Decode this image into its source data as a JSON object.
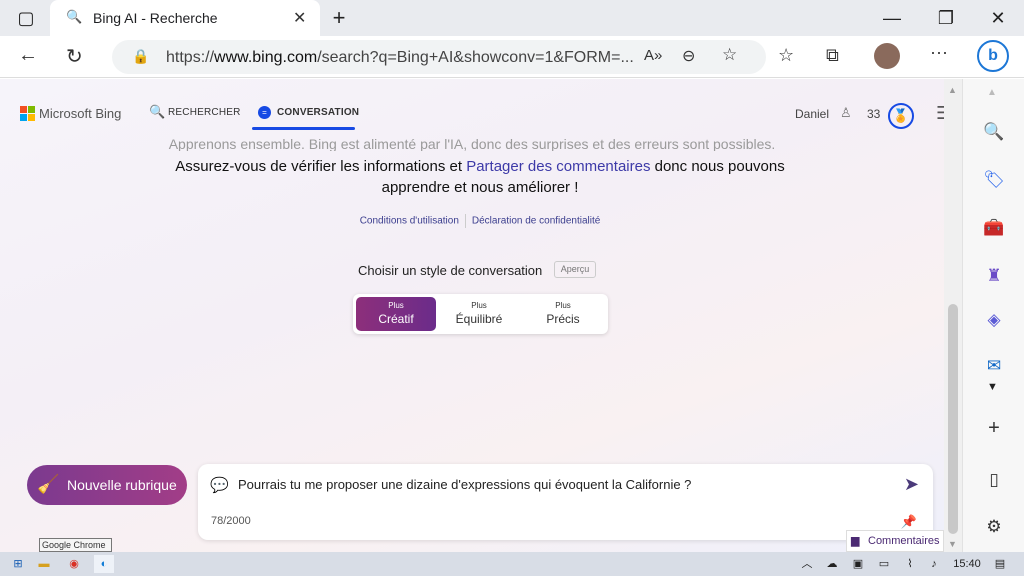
{
  "browser": {
    "tab_title": "Bing AI - Recherche",
    "url_prefix": "https://",
    "url_domain": "www.bing.com",
    "url_rest": "/search?q=Bing+AI&showconv=1&FORM=..."
  },
  "bing": {
    "brand": "Microsoft Bing",
    "nav_search": "RECHERCHER",
    "nav_chat": "CONVERSATION",
    "user_name": "Daniel",
    "points": "33"
  },
  "disclaimer": {
    "line1": "Apprenons ensemble. Bing est alimenté par l'IA, donc des surprises et des erreurs sont possibles.",
    "line2_a": "Assurez-vous de vérifier les informations et ",
    "line2_link": "Partager des commentaires",
    "line2_b": " donc nous pouvons",
    "line3": "apprendre et nous améliorer !"
  },
  "links": {
    "terms": "Conditions d'utilisation",
    "privacy": "Déclaration de confidentialité"
  },
  "style_selector": {
    "title": "Choisir un style de conversation",
    "badge": "Aperçu",
    "options": [
      {
        "small": "Plus",
        "label": "Créatif"
      },
      {
        "small": "Plus",
        "label": "Équilibré"
      },
      {
        "small": "Plus",
        "label": "Précis"
      }
    ]
  },
  "composer": {
    "new_topic": "Nouvelle rubrique",
    "message": "Pourrais tu me proposer une dizaine d'expressions qui évoquent la Californie ?",
    "counter": "78/2000"
  },
  "feedback_label": "Commentaires",
  "tooltip": "Google Chrome",
  "taskbar": {
    "time": "15:40"
  }
}
